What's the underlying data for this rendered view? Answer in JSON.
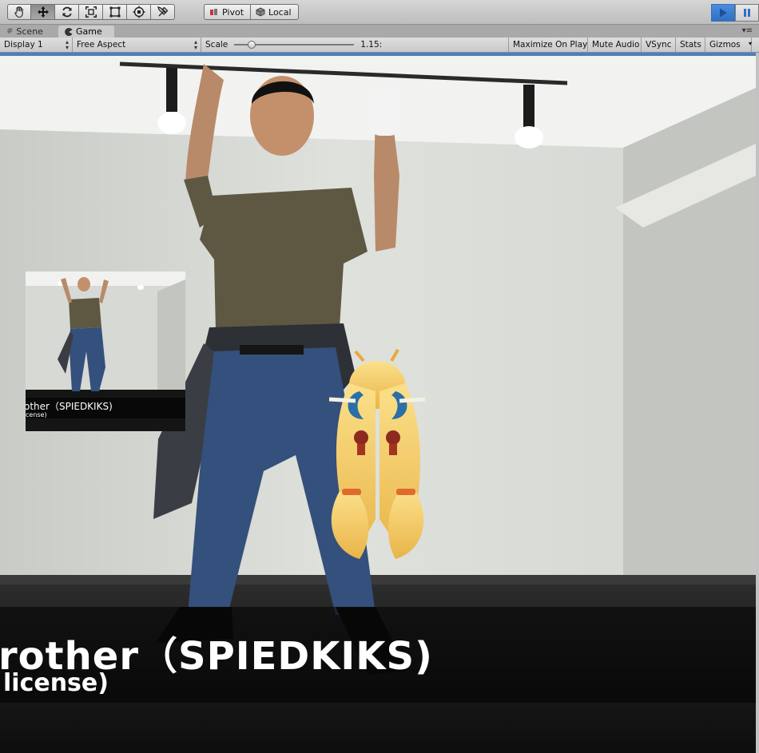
{
  "toolbar": {
    "tools": [
      {
        "icon": "hand-icon",
        "name": "hand-tool"
      },
      {
        "icon": "move-icon",
        "name": "move-tool"
      },
      {
        "icon": "rotate-icon",
        "name": "rotate-tool"
      },
      {
        "icon": "scale-icon",
        "name": "scale-tool"
      },
      {
        "icon": "rect-icon",
        "name": "rect-tool"
      },
      {
        "icon": "transform-icon",
        "name": "transform-tool"
      },
      {
        "icon": "custom-tool-icon",
        "name": "custom-tool"
      }
    ],
    "pivot_label": "Pivot",
    "local_label": "Local"
  },
  "tabs": {
    "scene_label": "Scene",
    "game_label": "Game"
  },
  "game_bar": {
    "display_label": "Display 1",
    "aspect_label": "Free Aspect",
    "scale_label": "Scale",
    "scale_value": "1.15:",
    "scale_fraction": 0.12,
    "maximize_label": "Maximize On Play",
    "mute_label": "Mute Audio",
    "vsync_label": "VSync",
    "stats_label": "Stats",
    "gizmos_label": "Gizmos"
  },
  "video": {
    "caption_line1": "rother（SPIEDKIKS)",
    "caption_line2": "license)",
    "thumb_caption_line1": "other（SPIEDKIKS)",
    "thumb_caption_line2": "cense)"
  },
  "colors": {
    "accent": "#4a7fc3",
    "play_blue": "#2f6fc4",
    "shirt": "#5e5842",
    "jeans": "#34507c",
    "hair": "#f3c75a"
  }
}
